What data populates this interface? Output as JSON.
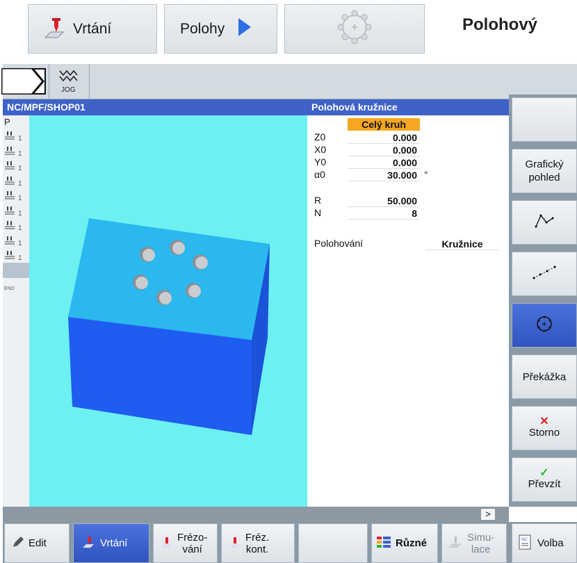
{
  "header": {
    "btn_drilling": "Vrtání",
    "btn_positions": "Polohy",
    "heading": "Polohový"
  },
  "screen": {
    "mode_label": "JOG",
    "path": "NC/MPF/SHOP01",
    "panel_title": "Polohová kružnice",
    "sidebar": {
      "top": "P",
      "items": [
        "1",
        "1",
        "1",
        "1",
        "1",
        "1",
        "1",
        "1",
        "1"
      ],
      "end": "END"
    },
    "params": {
      "type_value": "Celý kruh",
      "rows": [
        {
          "label": "Z0",
          "value": "0.000",
          "unit": ""
        },
        {
          "label": "X0",
          "value": "0.000",
          "unit": ""
        },
        {
          "label": "Y0",
          "value": "0.000",
          "unit": ""
        },
        {
          "label": "α0",
          "value": "30.000",
          "unit": "°"
        },
        {
          "label": "R",
          "value": "50.000",
          "unit": ""
        },
        {
          "label": "N",
          "value": "8",
          "unit": ""
        }
      ],
      "positioning_label": "Polohování",
      "positioning_value": "Kružnice"
    },
    "vertical_softkeys": [
      {
        "label": ""
      },
      {
        "label": "Grafický pohled",
        "line1": "Grafický",
        "line2": "pohled"
      },
      {
        "icon": "polyline-icon"
      },
      {
        "icon": "line-points-icon"
      },
      {
        "icon": "circle-positions-icon",
        "active": true
      },
      {
        "label": "Překážka"
      },
      {
        "label": "Storno",
        "icon": "cancel-x-icon"
      },
      {
        "label": "Převzít",
        "icon": "accept-check-icon"
      }
    ],
    "status_more": ">",
    "horizontal_softkeys": [
      {
        "label": "Edit"
      },
      {
        "label": "Vrtání",
        "active": true
      },
      {
        "line1": "Frézo-",
        "line2": "vání"
      },
      {
        "line1": "Fréz.",
        "line2": "kont."
      },
      {
        "label": ""
      },
      {
        "label": "Různé"
      },
      {
        "line1": "Simu-",
        "line2": "lace"
      },
      {
        "label": "Volba"
      }
    ]
  },
  "colors": {
    "accent_blue": "#3f62c8",
    "view_bg": "#6df0f2",
    "highlight_orange": "#f5a623",
    "block_top": "#2ab8ee",
    "block_front": "#1f5cf0",
    "block_side": "#1a52d8"
  }
}
